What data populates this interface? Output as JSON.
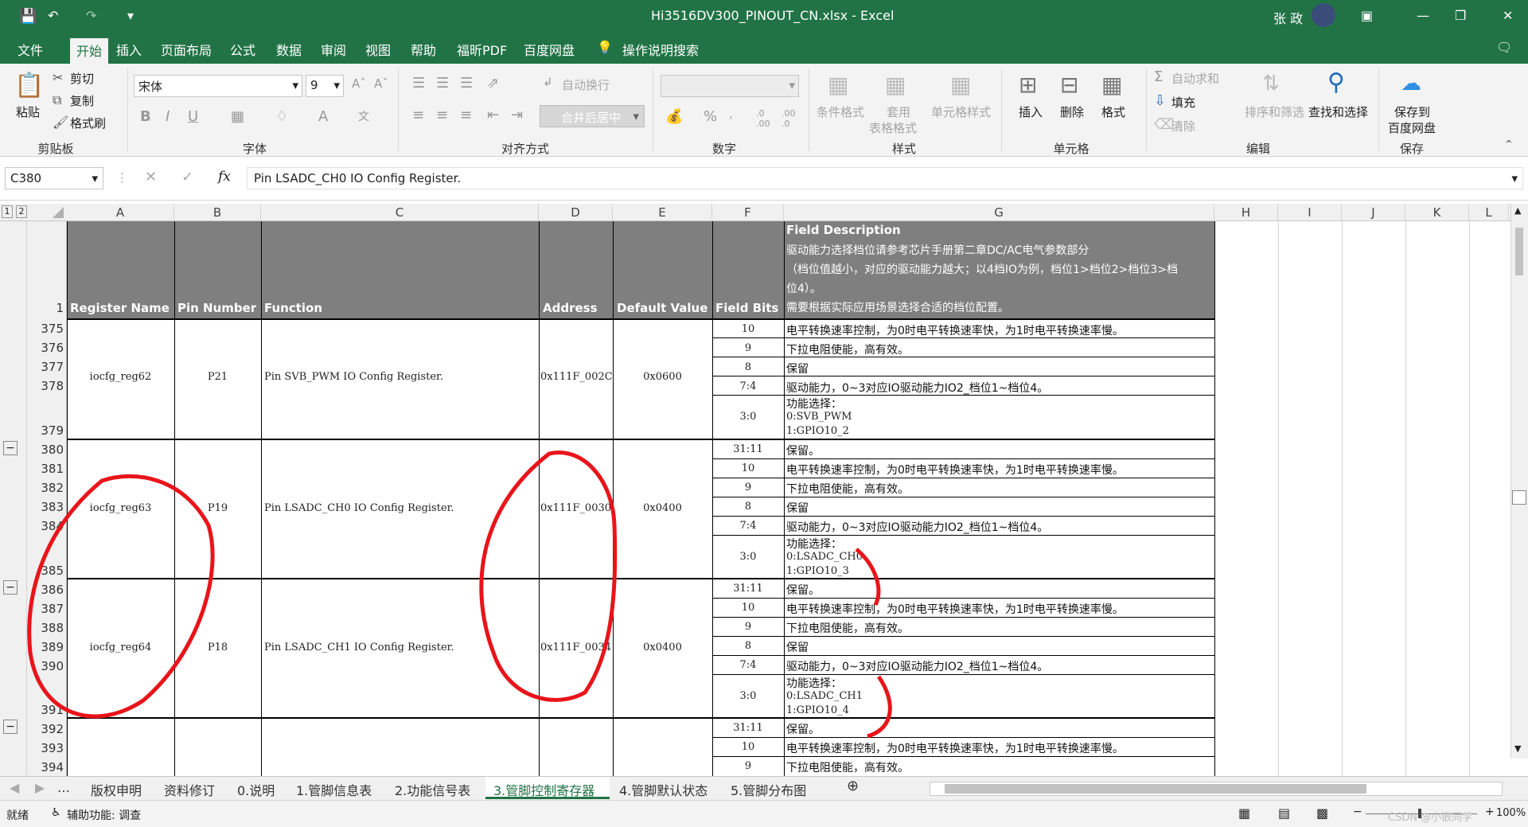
{
  "title_bar": {
    "window_title": "Hi3516DV300_PINOUT_CN.xlsx - Excel",
    "user_name": "张 政"
  },
  "tabs": [
    "文件",
    "开始",
    "插入",
    "页面布局",
    "公式",
    "数据",
    "审阅",
    "视图",
    "帮助",
    "福昕PDF",
    "百度网盘"
  ],
  "tell_me": "操作说明搜索",
  "ribbon": {
    "paste": "粘贴",
    "cut": "剪切",
    "copy": "复制",
    "format_painter": "格式刷",
    "clipboard": "剪贴板",
    "font_name": "宋体",
    "font_size": "9",
    "font_group": "字体",
    "wrap_text": "自动换行",
    "merge_center": "合并后居中",
    "alignment_group": "对齐方式",
    "number_group": "数字",
    "cond_format": "条件格式",
    "table_format_1": "套用",
    "table_format_2": "表格格式",
    "cell_styles": "单元格样式",
    "styles_group": "样式",
    "insert": "插入",
    "delete": "删除",
    "format": "格式",
    "cells_group": "单元格",
    "autosum": "自动求和",
    "fill": "填充",
    "clear": "清除",
    "sort_filter": "排序和筛选",
    "find_select": "查找和选择",
    "editing_group": "编辑",
    "save_baidu_1": "保存到",
    "save_baidu_2": "百度网盘",
    "save_group": "保存"
  },
  "formula_bar": {
    "name_box": "C380",
    "fx": "fx",
    "content": "Pin LSADC_CH0 IO Config Register."
  },
  "column_headers": [
    "A",
    "B",
    "C",
    "D",
    "E",
    "F",
    "G",
    "H",
    "I",
    "J",
    "K",
    "L"
  ],
  "outline_levels": [
    "1",
    "2"
  ],
  "header_row": {
    "row_number": "1",
    "register_name": "Register Name",
    "pin_number": "Pin Number",
    "function": "Function",
    "address": "Address",
    "default_value": "Default Value",
    "field_bits": "Field Bits",
    "desc_title": "Field Description",
    "desc_line1": "驱动能力选择档位请参考芯片手册第二章DC/AC电气参数部分",
    "desc_line2": "（档位值越小，对应的驱动能力越大；以4档IO为例，档位1>档位2>档位3>档",
    "desc_line3": "位4）。",
    "desc_line4": "需要根据实际应用场景选择合适的档位配置。"
  },
  "registers": [
    {
      "name": "iocfg_reg62",
      "pin": "P21",
      "function": "Pin SVB_PWM IO Config Register.",
      "address": "0x111F_002C",
      "default": "0x0600"
    },
    {
      "name": "iocfg_reg63",
      "pin": "P19",
      "function": "Pin LSADC_CH0 IO Config Register.",
      "address": "0x111F_0030",
      "default": "0x0400"
    },
    {
      "name": "iocfg_reg64",
      "pin": "P18",
      "function": "Pin LSADC_CH1 IO Config Register.",
      "address": "0x111F_0034",
      "default": "0x0400"
    }
  ],
  "rows": [
    {
      "num": "375",
      "bits": "10",
      "desc": "电平转换速率控制，为0时电平转换速率快，为1时电平转换速率慢。"
    },
    {
      "num": "376",
      "bits": "9",
      "desc": "下拉电阻使能，高有效。"
    },
    {
      "num": "377",
      "bits": "8",
      "desc": "保留"
    },
    {
      "num": "378",
      "bits": "7:4",
      "desc": "驱动能力，0~3对应IO驱动能力IO2_档位1~档位4。"
    },
    {
      "num": "379",
      "bits": "3:0",
      "desc": "功能选择：",
      "desc2": "0:SVB_PWM",
      "desc3": "1:GPIO10_2"
    },
    {
      "num": "380",
      "bits": "31:11",
      "desc": "保留。"
    },
    {
      "num": "381",
      "bits": "10",
      "desc": "电平转换速率控制，为0时电平转换速率快，为1时电平转换速率慢。"
    },
    {
      "num": "382",
      "bits": "9",
      "desc": "下拉电阻使能，高有效。"
    },
    {
      "num": "383",
      "bits": "8",
      "desc": "保留"
    },
    {
      "num": "384",
      "bits": "7:4",
      "desc": "驱动能力，0~3对应IO驱动能力IO2_档位1~档位4。"
    },
    {
      "num": "385",
      "bits": "3:0",
      "desc": "功能选择：",
      "desc2": "0:LSADC_CH0",
      "desc3": "1:GPIO10_3"
    },
    {
      "num": "386",
      "bits": "31:11",
      "desc": "保留。"
    },
    {
      "num": "387",
      "bits": "10",
      "desc": "电平转换速率控制，为0时电平转换速率快，为1时电平转换速率慢。"
    },
    {
      "num": "388",
      "bits": "9",
      "desc": "下拉电阻使能，高有效。"
    },
    {
      "num": "389",
      "bits": "8",
      "desc": "保留"
    },
    {
      "num": "390",
      "bits": "7:4",
      "desc": "驱动能力，0~3对应IO驱动能力IO2_档位1~档位4。"
    },
    {
      "num": "391",
      "bits": "3:0",
      "desc": "功能选择：",
      "desc2": "0:LSADC_CH1",
      "desc3": "1:GPIO10_4"
    },
    {
      "num": "392",
      "bits": "31:11",
      "desc": "保留。"
    },
    {
      "num": "393",
      "bits": "10",
      "desc": "电平转换速率控制，为0时电平转换速率快，为1时电平转换速率慢。"
    },
    {
      "num": "394",
      "bits": "9",
      "desc": "下拉电阻使能，高有效。"
    }
  ],
  "sheet_tabs": [
    "版权申明",
    "资料修订",
    "0.说明",
    "1.管脚信息表",
    "2.功能信号表",
    "3.管脚控制寄存器",
    "4.管脚默认状态",
    "5.管脚分布图"
  ],
  "active_sheet": "3.管脚控制寄存器",
  "status": {
    "ready": "就绪",
    "accessibility": "辅助功能: 调查",
    "zoom": "100%",
    "watermark": "CSDN @小嵌同学"
  },
  "colors": {
    "excel_green": "#217346",
    "annotation_red": "#e8141a",
    "header_gray": "#7f7f7f"
  }
}
